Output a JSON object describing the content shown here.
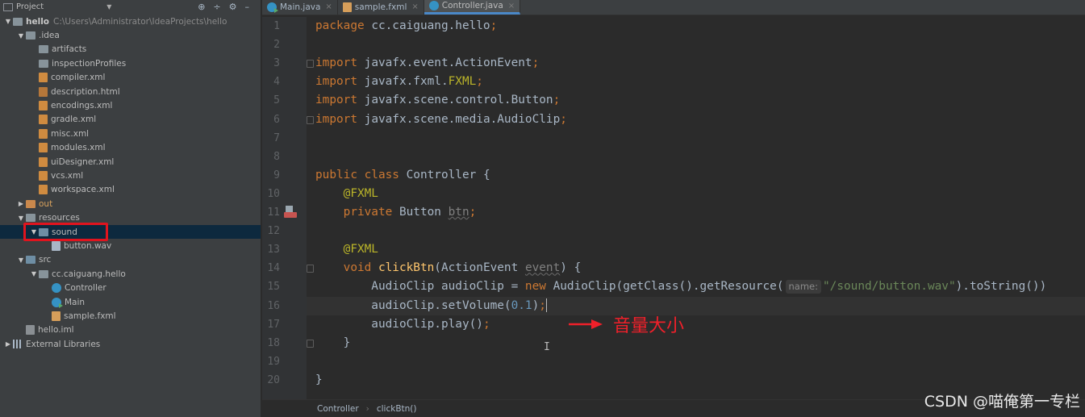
{
  "project_panel": {
    "title": "Project",
    "tools": [
      "⊕",
      "÷",
      "⚙",
      "–"
    ],
    "tree": [
      {
        "indent": 0,
        "arrow": "open",
        "icon": "module",
        "label": "hello",
        "detail": "C:\\Users\\Administrator\\IdeaProjects\\hello",
        "bold": true
      },
      {
        "indent": 1,
        "arrow": "open",
        "icon": "folder",
        "label": ".idea"
      },
      {
        "indent": 2,
        "arrow": "none",
        "icon": "folder",
        "label": "artifacts"
      },
      {
        "indent": 2,
        "arrow": "none",
        "icon": "folder",
        "label": "inspectionProfiles"
      },
      {
        "indent": 2,
        "arrow": "none",
        "icon": "xml",
        "label": "compiler.xml"
      },
      {
        "indent": 2,
        "arrow": "none",
        "icon": "html",
        "label": "description.html"
      },
      {
        "indent": 2,
        "arrow": "none",
        "icon": "xml",
        "label": "encodings.xml"
      },
      {
        "indent": 2,
        "arrow": "none",
        "icon": "xml",
        "label": "gradle.xml"
      },
      {
        "indent": 2,
        "arrow": "none",
        "icon": "xml",
        "label": "misc.xml"
      },
      {
        "indent": 2,
        "arrow": "none",
        "icon": "xml",
        "label": "modules.xml"
      },
      {
        "indent": 2,
        "arrow": "none",
        "icon": "xml",
        "label": "uiDesigner.xml"
      },
      {
        "indent": 2,
        "arrow": "none",
        "icon": "xml",
        "label": "vcs.xml"
      },
      {
        "indent": 2,
        "arrow": "none",
        "icon": "xml",
        "label": "workspace.xml"
      },
      {
        "indent": 1,
        "arrow": "closed",
        "icon": "folder-orange",
        "label": "out",
        "out": true
      },
      {
        "indent": 1,
        "arrow": "open",
        "icon": "folder",
        "label": "resources"
      },
      {
        "indent": 2,
        "arrow": "open",
        "icon": "folder-blue",
        "label": "sound",
        "selected": true
      },
      {
        "indent": 3,
        "arrow": "none",
        "icon": "wav",
        "label": "button.wav"
      },
      {
        "indent": 1,
        "arrow": "open",
        "icon": "folder-blue",
        "label": "src"
      },
      {
        "indent": 2,
        "arrow": "open",
        "icon": "package",
        "label": "cc.caiguang.hello"
      },
      {
        "indent": 3,
        "arrow": "none",
        "icon": "cls",
        "label": "Controller"
      },
      {
        "indent": 3,
        "arrow": "none",
        "icon": "cls-run",
        "label": "Main"
      },
      {
        "indent": 3,
        "arrow": "none",
        "icon": "fxml",
        "label": "sample.fxml"
      },
      {
        "indent": 1,
        "arrow": "none",
        "icon": "iml",
        "label": "hello.iml"
      },
      {
        "indent": 0,
        "arrow": "closed",
        "icon": "libs",
        "label": "External Libraries"
      }
    ]
  },
  "tabs": [
    {
      "label": "Main.java",
      "icon": "cls-run",
      "active": false
    },
    {
      "label": "sample.fxml",
      "icon": "fxml",
      "active": false
    },
    {
      "label": "Controller.java",
      "icon": "cls",
      "active": true
    }
  ],
  "tab_close_glyph": "×",
  "editor": {
    "line_numbers": [
      "1",
      "2",
      "3",
      "4",
      "5",
      "6",
      "7",
      "8",
      "9",
      "10",
      "11",
      "12",
      "13",
      "14",
      "15",
      "16",
      "17",
      "18",
      "19",
      "20"
    ],
    "current_line": 16,
    "lines": [
      [
        {
          "t": "package ",
          "c": "kw"
        },
        {
          "t": "cc.caiguang.hello",
          "c": ""
        },
        {
          "t": ";",
          "c": "kw"
        }
      ],
      [],
      [
        {
          "t": "import ",
          "c": "kw"
        },
        {
          "t": "javafx.event.ActionEvent",
          "c": ""
        },
        {
          "t": ";",
          "c": "kw"
        }
      ],
      [
        {
          "t": "import ",
          "c": "kw"
        },
        {
          "t": "javafx.fxml.",
          "c": ""
        },
        {
          "t": "FXML",
          "c": "fxml-hl"
        },
        {
          "t": ";",
          "c": "kw"
        }
      ],
      [
        {
          "t": "import ",
          "c": "kw"
        },
        {
          "t": "javafx.scene.control.Button",
          "c": ""
        },
        {
          "t": ";",
          "c": "kw"
        }
      ],
      [
        {
          "t": "import ",
          "c": "kw"
        },
        {
          "t": "javafx.scene.media.AudioClip",
          "c": ""
        },
        {
          "t": ";",
          "c": "kw"
        }
      ],
      [],
      [],
      [
        {
          "t": "public class ",
          "c": "kw"
        },
        {
          "t": "Controller {",
          "c": ""
        }
      ],
      [
        {
          "t": "    ",
          "c": ""
        },
        {
          "t": "@FXML",
          "c": "ann"
        }
      ],
      [
        {
          "t": "    ",
          "c": ""
        },
        {
          "t": "private ",
          "c": "kw"
        },
        {
          "t": "Button ",
          "c": ""
        },
        {
          "t": "btn",
          "c": "unused squiggle"
        },
        {
          "t": ";",
          "c": "kw"
        }
      ],
      [],
      [
        {
          "t": "    ",
          "c": ""
        },
        {
          "t": "@FXML",
          "c": "ann"
        }
      ],
      [
        {
          "t": "    ",
          "c": ""
        },
        {
          "t": "void ",
          "c": "kw"
        },
        {
          "t": "clickBtn",
          "c": "fn"
        },
        {
          "t": "(ActionEvent ",
          "c": ""
        },
        {
          "t": "event",
          "c": "unused squiggle"
        },
        {
          "t": ") {",
          "c": ""
        }
      ],
      [
        {
          "t": "        AudioClip audioClip = ",
          "c": ""
        },
        {
          "t": "new ",
          "c": "kw"
        },
        {
          "t": "AudioClip(getClass().getResource(",
          "c": ""
        },
        {
          "t": "name:",
          "c": "hint"
        },
        {
          "t": "\"/sound/button.wav\"",
          "c": "str"
        },
        {
          "t": ").toString())",
          "c": ""
        }
      ],
      [
        {
          "t": "        audioClip.setVolume(",
          "c": ""
        },
        {
          "t": "0.1",
          "c": "num"
        },
        {
          "t": ")",
          "c": ""
        },
        {
          "t": ";",
          "c": "kw"
        },
        {
          "t": "",
          "c": "caret"
        }
      ],
      [
        {
          "t": "        audioClip.play()",
          "c": ""
        },
        {
          "t": ";",
          "c": "kw"
        }
      ],
      [
        {
          "t": "    }",
          "c": ""
        }
      ],
      [],
      [
        {
          "t": "}",
          "c": ""
        }
      ]
    ],
    "fold_lines": [
      3,
      6,
      14,
      18
    ]
  },
  "annotation": {
    "text": "音量大小",
    "color": "#f0202a"
  },
  "breadcrumb": {
    "items": [
      "Controller",
      "clickBtn()"
    ]
  },
  "watermark": "CSDN @喵俺第一专栏",
  "colors": {
    "keyword": "#cc7832",
    "annotation": "#bbb529",
    "string": "#6a8759",
    "number": "#6897bb",
    "method": "#ffc66d",
    "text": "#a9b7c6",
    "selection": "#0d293e",
    "highlight_box": "#e0141e"
  }
}
